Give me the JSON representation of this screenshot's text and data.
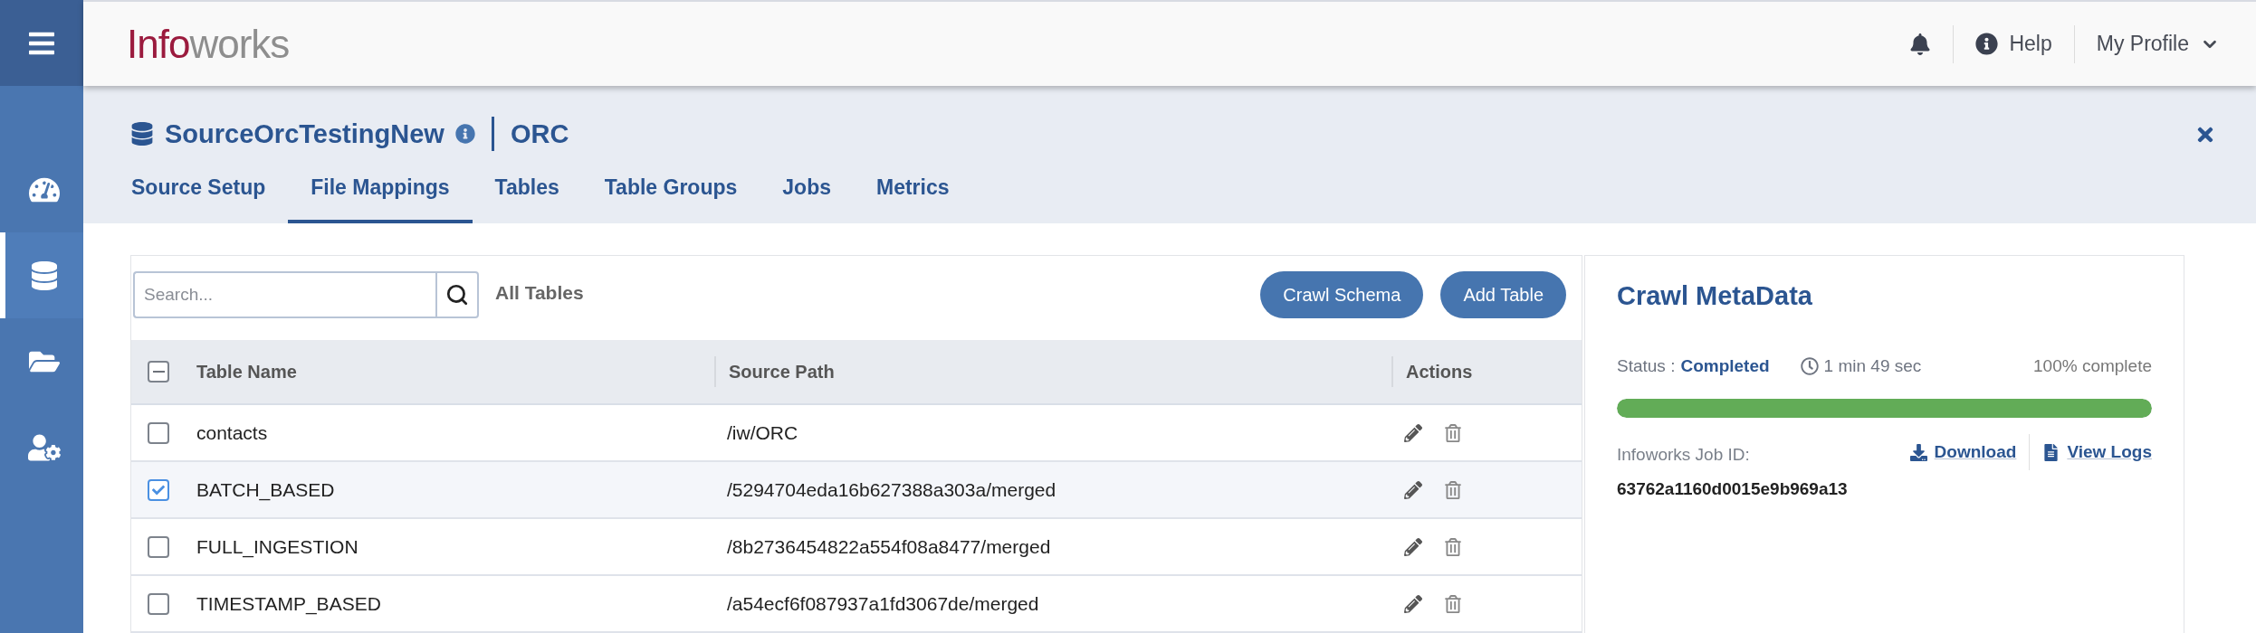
{
  "sidebar": {
    "items": [
      {
        "kind": "dashboard",
        "selected": false
      },
      {
        "kind": "database",
        "selected": true
      },
      {
        "kind": "folder",
        "selected": false
      },
      {
        "kind": "users",
        "selected": false
      }
    ]
  },
  "header": {
    "logo": {
      "primary": "Info",
      "secondary": "works"
    },
    "help": "Help",
    "profile": "My Profile"
  },
  "source": {
    "name": "SourceOrcTestingNew",
    "type": "ORC"
  },
  "tabs": [
    {
      "label": "Source Setup",
      "selected": false
    },
    {
      "label": "File Mappings",
      "selected": true
    },
    {
      "label": "Tables",
      "selected": false
    },
    {
      "label": "Table Groups",
      "selected": false
    },
    {
      "label": "Jobs",
      "selected": false
    },
    {
      "label": "Metrics",
      "selected": false
    }
  ],
  "toolbar": {
    "search_placeholder": "Search...",
    "filter": "All Tables",
    "buttons": [
      "Crawl Schema",
      "Add Table"
    ]
  },
  "table": {
    "select_all_indeterminate": true,
    "columns": [
      "Table Name",
      "Source Path",
      "Actions"
    ],
    "rows": [
      {
        "name": "contacts",
        "path": "/iw/ORC",
        "checked": false
      },
      {
        "name": "BATCH_BASED",
        "path": "/5294704eda16b627388a303a/merged",
        "checked": true
      },
      {
        "name": "FULL_INGESTION",
        "path": "/8b2736454822a554f08a8477/merged",
        "checked": false
      },
      {
        "name": "TIMESTAMP_BASED",
        "path": "/a54ecf6f087937a1fd3067de/merged",
        "checked": false
      }
    ]
  },
  "crawl": {
    "title": "Crawl MetaData",
    "status_label": "Status :",
    "status": "Completed",
    "duration": "1 min 49 sec",
    "percent": "100% complete",
    "level": 1,
    "job_id_label": "Infoworks Job ID:",
    "job_id": "63762a1160d0015e9b969a13",
    "links": [
      {
        "kind": "download",
        "label": "Download"
      },
      {
        "kind": "logs",
        "label": "View Logs"
      }
    ]
  }
}
